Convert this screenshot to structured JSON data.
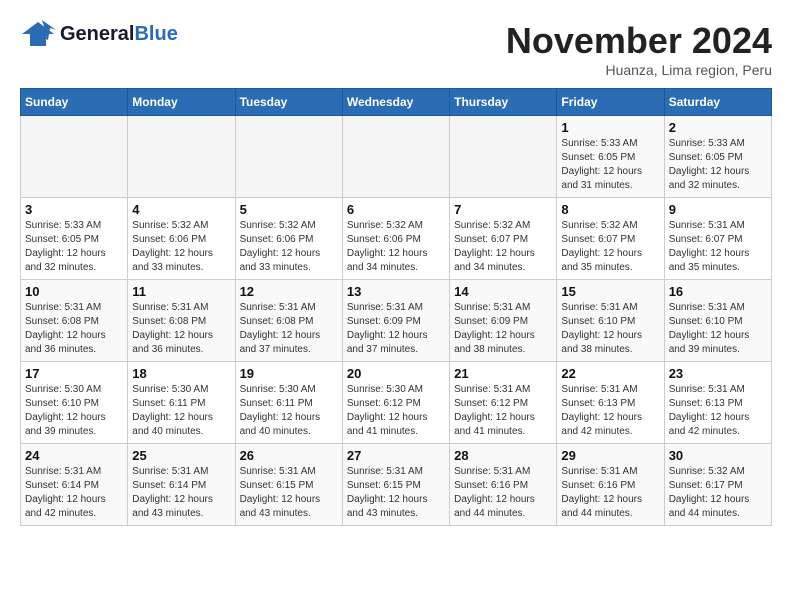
{
  "header": {
    "logo_general": "General",
    "logo_blue": "Blue",
    "month_title": "November 2024",
    "subtitle": "Huanza, Lima region, Peru"
  },
  "weekdays": [
    "Sunday",
    "Monday",
    "Tuesday",
    "Wednesday",
    "Thursday",
    "Friday",
    "Saturday"
  ],
  "weeks": [
    [
      {
        "day": "",
        "info": ""
      },
      {
        "day": "",
        "info": ""
      },
      {
        "day": "",
        "info": ""
      },
      {
        "day": "",
        "info": ""
      },
      {
        "day": "",
        "info": ""
      },
      {
        "day": "1",
        "info": "Sunrise: 5:33 AM\nSunset: 6:05 PM\nDaylight: 12 hours and 31 minutes."
      },
      {
        "day": "2",
        "info": "Sunrise: 5:33 AM\nSunset: 6:05 PM\nDaylight: 12 hours and 32 minutes."
      }
    ],
    [
      {
        "day": "3",
        "info": "Sunrise: 5:33 AM\nSunset: 6:05 PM\nDaylight: 12 hours and 32 minutes."
      },
      {
        "day": "4",
        "info": "Sunrise: 5:32 AM\nSunset: 6:06 PM\nDaylight: 12 hours and 33 minutes."
      },
      {
        "day": "5",
        "info": "Sunrise: 5:32 AM\nSunset: 6:06 PM\nDaylight: 12 hours and 33 minutes."
      },
      {
        "day": "6",
        "info": "Sunrise: 5:32 AM\nSunset: 6:06 PM\nDaylight: 12 hours and 34 minutes."
      },
      {
        "day": "7",
        "info": "Sunrise: 5:32 AM\nSunset: 6:07 PM\nDaylight: 12 hours and 34 minutes."
      },
      {
        "day": "8",
        "info": "Sunrise: 5:32 AM\nSunset: 6:07 PM\nDaylight: 12 hours and 35 minutes."
      },
      {
        "day": "9",
        "info": "Sunrise: 5:31 AM\nSunset: 6:07 PM\nDaylight: 12 hours and 35 minutes."
      }
    ],
    [
      {
        "day": "10",
        "info": "Sunrise: 5:31 AM\nSunset: 6:08 PM\nDaylight: 12 hours and 36 minutes."
      },
      {
        "day": "11",
        "info": "Sunrise: 5:31 AM\nSunset: 6:08 PM\nDaylight: 12 hours and 36 minutes."
      },
      {
        "day": "12",
        "info": "Sunrise: 5:31 AM\nSunset: 6:08 PM\nDaylight: 12 hours and 37 minutes."
      },
      {
        "day": "13",
        "info": "Sunrise: 5:31 AM\nSunset: 6:09 PM\nDaylight: 12 hours and 37 minutes."
      },
      {
        "day": "14",
        "info": "Sunrise: 5:31 AM\nSunset: 6:09 PM\nDaylight: 12 hours and 38 minutes."
      },
      {
        "day": "15",
        "info": "Sunrise: 5:31 AM\nSunset: 6:10 PM\nDaylight: 12 hours and 38 minutes."
      },
      {
        "day": "16",
        "info": "Sunrise: 5:31 AM\nSunset: 6:10 PM\nDaylight: 12 hours and 39 minutes."
      }
    ],
    [
      {
        "day": "17",
        "info": "Sunrise: 5:30 AM\nSunset: 6:10 PM\nDaylight: 12 hours and 39 minutes."
      },
      {
        "day": "18",
        "info": "Sunrise: 5:30 AM\nSunset: 6:11 PM\nDaylight: 12 hours and 40 minutes."
      },
      {
        "day": "19",
        "info": "Sunrise: 5:30 AM\nSunset: 6:11 PM\nDaylight: 12 hours and 40 minutes."
      },
      {
        "day": "20",
        "info": "Sunrise: 5:30 AM\nSunset: 6:12 PM\nDaylight: 12 hours and 41 minutes."
      },
      {
        "day": "21",
        "info": "Sunrise: 5:31 AM\nSunset: 6:12 PM\nDaylight: 12 hours and 41 minutes."
      },
      {
        "day": "22",
        "info": "Sunrise: 5:31 AM\nSunset: 6:13 PM\nDaylight: 12 hours and 42 minutes."
      },
      {
        "day": "23",
        "info": "Sunrise: 5:31 AM\nSunset: 6:13 PM\nDaylight: 12 hours and 42 minutes."
      }
    ],
    [
      {
        "day": "24",
        "info": "Sunrise: 5:31 AM\nSunset: 6:14 PM\nDaylight: 12 hours and 42 minutes."
      },
      {
        "day": "25",
        "info": "Sunrise: 5:31 AM\nSunset: 6:14 PM\nDaylight: 12 hours and 43 minutes."
      },
      {
        "day": "26",
        "info": "Sunrise: 5:31 AM\nSunset: 6:15 PM\nDaylight: 12 hours and 43 minutes."
      },
      {
        "day": "27",
        "info": "Sunrise: 5:31 AM\nSunset: 6:15 PM\nDaylight: 12 hours and 43 minutes."
      },
      {
        "day": "28",
        "info": "Sunrise: 5:31 AM\nSunset: 6:16 PM\nDaylight: 12 hours and 44 minutes."
      },
      {
        "day": "29",
        "info": "Sunrise: 5:31 AM\nSunset: 6:16 PM\nDaylight: 12 hours and 44 minutes."
      },
      {
        "day": "30",
        "info": "Sunrise: 5:32 AM\nSunset: 6:17 PM\nDaylight: 12 hours and 44 minutes."
      }
    ]
  ]
}
